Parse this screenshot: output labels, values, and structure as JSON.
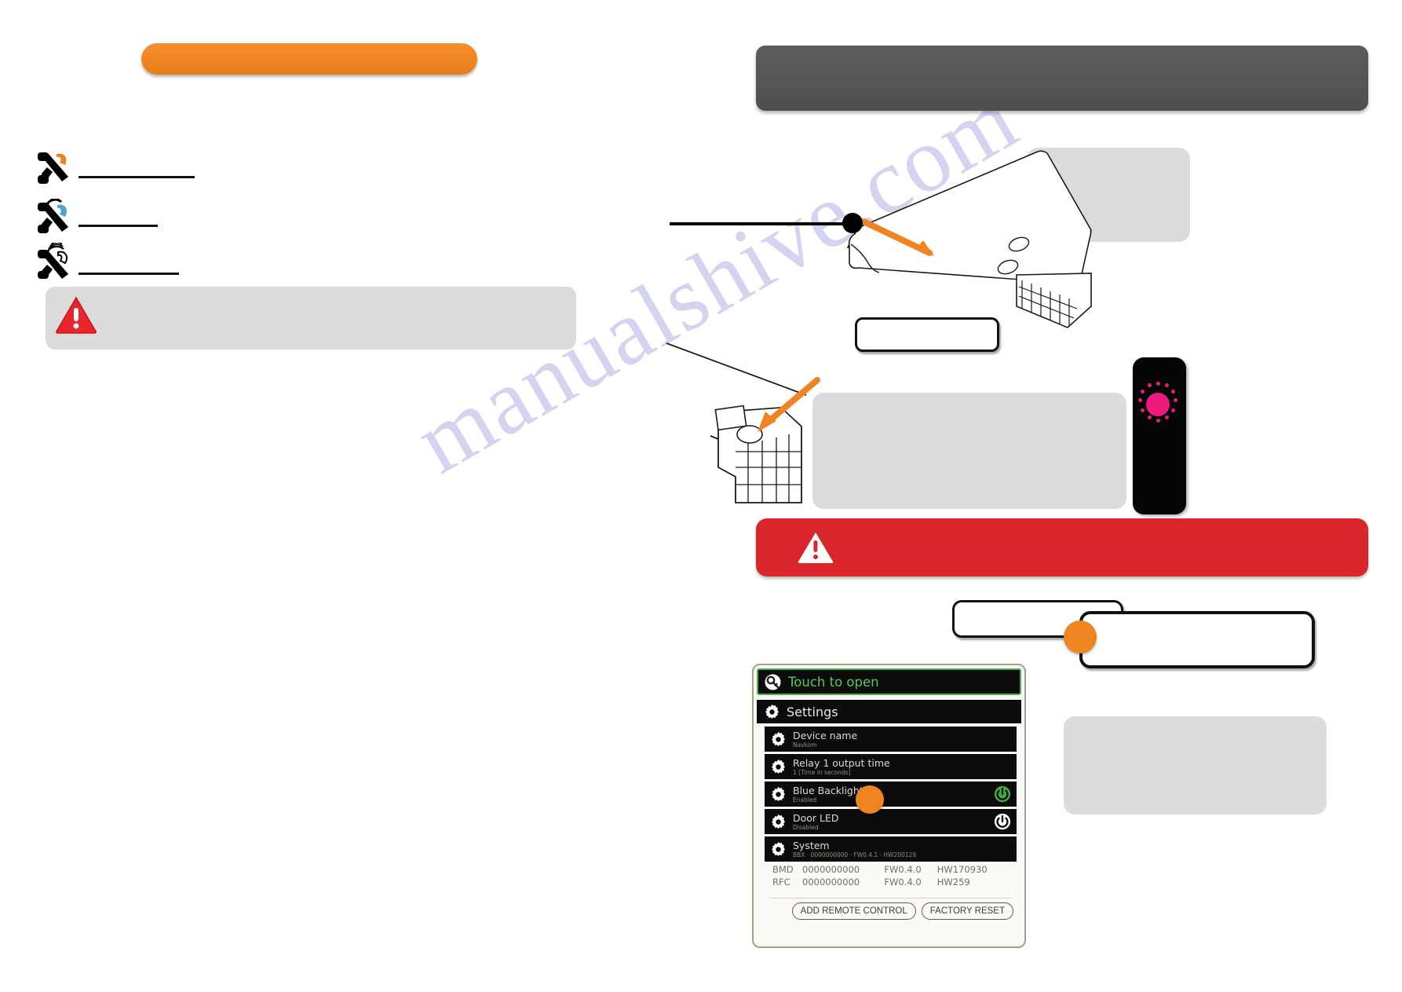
{
  "page": {
    "watermark": "manualshive.com",
    "background": "#ffffff",
    "accent_orange": "#ef8521",
    "accent_red": "#d8262c",
    "accent_green": "#4caf50",
    "accent_magenta": "#ec1a7e",
    "header_dark": "#555555"
  },
  "left_column": {
    "title_bar": {
      "label": "",
      "color": "#ef8521"
    },
    "list": [
      {
        "icon": "phone-call-orange-icon",
        "label": ""
      },
      {
        "icon": "phone-call-blue-icon",
        "label": ""
      },
      {
        "icon": "phone-signal-icon",
        "label": ""
      }
    ],
    "note_box": {
      "icon": "warning-triangle-icon",
      "text": "",
      "color": "#dcdcdc"
    }
  },
  "right_column": {
    "title_bar": {
      "label": "",
      "color": "#555555"
    },
    "device_figure_1": {
      "name": "relay-module-top-view",
      "leader_label": "",
      "callout_note": {
        "text": "",
        "color": "#dcdcdc"
      },
      "caption_box": {
        "text": ""
      },
      "arrow": {
        "color": "#ef8521",
        "points_to": "reset-button"
      }
    },
    "device_figure_2": {
      "name": "relay-module-connector-view",
      "note_box": {
        "text": "",
        "color": "#dcdcdc"
      },
      "arrow": {
        "color": "#ef8521",
        "points_to": "connector-pin"
      }
    },
    "reader": {
      "name": "door-reader",
      "led_state": "blinking",
      "led_color": "#ec1a7e"
    },
    "warning_banner": {
      "icon": "warning-triangle-icon",
      "text": "",
      "color": "#d8262c"
    },
    "callout_right_1": {
      "text": ""
    },
    "callout_right_2": {
      "text": ""
    },
    "grey_note_bottom": {
      "text": "",
      "color": "#dcdcdc"
    }
  },
  "app_screenshot": {
    "name": "mobile-app-settings",
    "touch_to_open": {
      "label": "Touch to open",
      "icon": "key-icon"
    },
    "settings_header": {
      "label": "Settings",
      "icon": "gear-icon"
    },
    "rows": [
      {
        "icon": "gear-icon",
        "title": "Device name",
        "subtitle": "Navkom",
        "toggle": null
      },
      {
        "icon": "gear-icon",
        "title": "Relay 1 output time",
        "subtitle": "1 [Time in seconds]",
        "toggle": null
      },
      {
        "icon": "gear-icon",
        "title": "Blue Backlight",
        "subtitle": "Enabled",
        "toggle": "on"
      },
      {
        "icon": "gear-icon",
        "title": "Door LED",
        "subtitle": "Disabled",
        "toggle": "off"
      },
      {
        "icon": "gear-icon",
        "title": "System",
        "subtitle": "BBX · 0000000000 · FW0.4.1 · HW200129",
        "toggle": null
      }
    ],
    "system_table": {
      "rows": [
        {
          "module": "BMD",
          "serial": "0000000000",
          "firmware": "FW0.4.0",
          "hardware": "HW170930"
        },
        {
          "module": "RFC",
          "serial": "0000000000",
          "firmware": "FW0.4.0",
          "hardware": "HW259"
        }
      ]
    },
    "buttons": [
      {
        "label": "ADD REMOTE CONTROL"
      },
      {
        "label": "FACTORY RESET"
      }
    ],
    "highlight_dot": {
      "color": "#ef8521"
    }
  }
}
